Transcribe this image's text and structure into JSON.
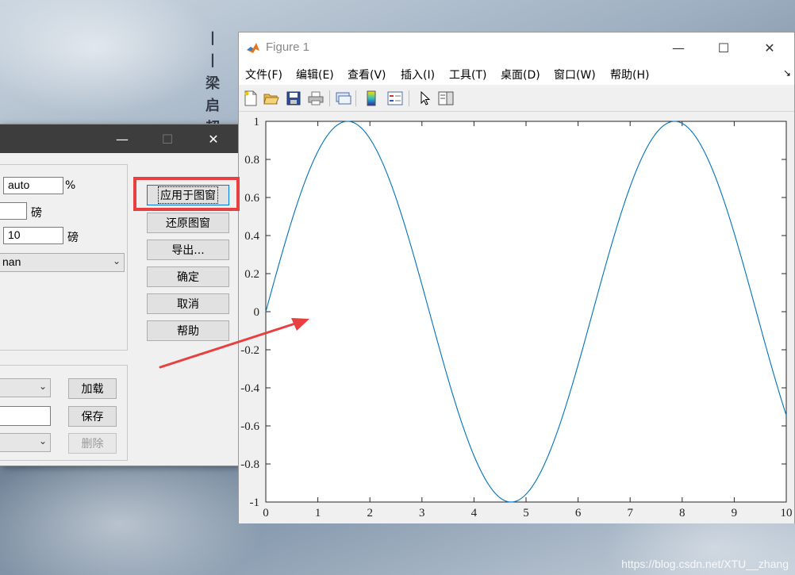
{
  "desktop": {
    "calligraphy": [
      "丨",
      "丨",
      "梁",
      "启",
      "超"
    ],
    "watermark": "https://blog.csdn.net/XTU__zhang"
  },
  "dialog": {
    "controls": {
      "minimize": "—",
      "maximize": "☐",
      "close": "✕"
    },
    "fields": {
      "width_value": "auto",
      "width_unit": "%",
      "line_unit": "磅",
      "font_size_value": "10",
      "font_size_unit": "磅",
      "font_name_value": "nan"
    },
    "buttons": {
      "apply": "应用于图窗",
      "restore": "还原图窗",
      "export": "导出...",
      "ok": "确定",
      "cancel": "取消",
      "help": "帮助",
      "load": "加载",
      "save": "保存",
      "delete": "删除"
    }
  },
  "figure": {
    "title": "Figure 1",
    "controls": {
      "minimize": "—",
      "maximize": "☐",
      "close": "✕"
    },
    "menu": [
      "文件(F)",
      "编辑(E)",
      "查看(V)",
      "插入(I)",
      "工具(T)",
      "桌面(D)",
      "窗口(W)",
      "帮助(H)"
    ],
    "menu_more": "↘",
    "toolbar_icons": [
      "new-figure-icon",
      "open-file-icon",
      "save-icon",
      "print-icon",
      "link-plot-icon",
      "colorbar-icon",
      "legend-icon",
      "pointer-icon",
      "property-editor-icon"
    ]
  },
  "chart_data": {
    "type": "line",
    "function": "sin(x)",
    "xlim": [
      0,
      10
    ],
    "ylim": [
      -1,
      1
    ],
    "x_ticks": [
      "0",
      "1",
      "2",
      "3",
      "4",
      "5",
      "6",
      "7",
      "8",
      "9",
      "10"
    ],
    "y_ticks": [
      "1",
      "0.8",
      "0.6",
      "0.4",
      "0.2",
      "0",
      "-0.2",
      "-0.4",
      "-0.6",
      "-0.8",
      "-1"
    ],
    "series": [
      {
        "color": "#0072BD",
        "x": [
          0,
          0.5,
          1,
          1.5,
          1.57,
          2,
          2.5,
          3,
          3.5,
          4,
          4.5,
          4.71,
          5,
          5.5,
          6,
          6.5,
          7,
          7.5,
          7.85,
          8,
          8.5,
          9,
          9.5,
          10
        ],
        "y": [
          0,
          0.479,
          0.841,
          0.997,
          1,
          0.909,
          0.598,
          0.141,
          -0.351,
          -0.757,
          -0.978,
          -1,
          -0.959,
          -0.706,
          -0.279,
          0.215,
          0.657,
          0.938,
          1,
          0.989,
          0.798,
          0.412,
          -0.075,
          -0.544
        ]
      }
    ],
    "grid": false
  },
  "annotation": {
    "arrow_color": "#e84040",
    "highlight_color": "#e84040"
  }
}
